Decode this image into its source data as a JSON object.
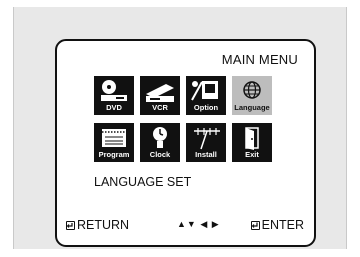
{
  "menu": {
    "title": "MAIN MENU",
    "items": [
      {
        "label": "DVD",
        "icon": "dvd-player-icon",
        "selected": false
      },
      {
        "label": "VCR",
        "icon": "vcr-icon",
        "selected": false
      },
      {
        "label": "Option",
        "icon": "option-icon",
        "selected": false
      },
      {
        "label": "Language",
        "icon": "globe-icon",
        "selected": true
      },
      {
        "label": "Program",
        "icon": "calendar-icon",
        "selected": false
      },
      {
        "label": "Clock",
        "icon": "clock-icon",
        "selected": false
      },
      {
        "label": "Install",
        "icon": "antenna-icon",
        "selected": false
      },
      {
        "label": "Exit",
        "icon": "exit-door-icon",
        "selected": false
      }
    ]
  },
  "section_label": "LANGUAGE SET",
  "footer": {
    "return_label": "RETURN",
    "nav_arrows": "▲▼ ◀ ▶",
    "enter_label": "ENTER"
  },
  "colors": {
    "tile": "#111111",
    "tile_selected": "#bdbdbd",
    "panel": "#e8e8e8"
  }
}
